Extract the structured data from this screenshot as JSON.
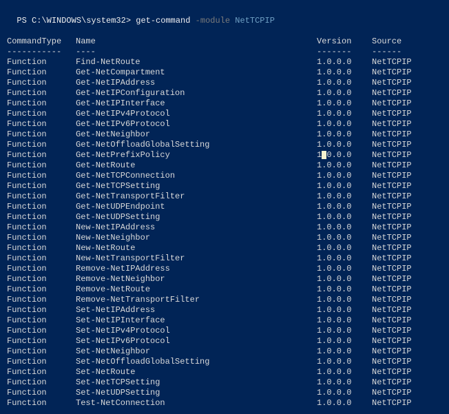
{
  "prompt": {
    "path": "PS C:\\WINDOWS\\system32>",
    "command": "get-command",
    "parameter": "-module",
    "argument": "NetTCPIP"
  },
  "headers": {
    "type": "CommandType",
    "name": "Name",
    "version": "Version",
    "source": "Source"
  },
  "dashes": {
    "type": "-----------",
    "name": "----",
    "version": "-------",
    "source": "------"
  },
  "cursor_row_index": 9,
  "chart_data": {
    "type": "table",
    "title": "get-command -module NetTCPIP",
    "columns": [
      "CommandType",
      "Name",
      "Version",
      "Source"
    ],
    "rows": [
      [
        "Function",
        "Find-NetRoute",
        "1.0.0.0",
        "NetTCPIP"
      ],
      [
        "Function",
        "Get-NetCompartment",
        "1.0.0.0",
        "NetTCPIP"
      ],
      [
        "Function",
        "Get-NetIPAddress",
        "1.0.0.0",
        "NetTCPIP"
      ],
      [
        "Function",
        "Get-NetIPConfiguration",
        "1.0.0.0",
        "NetTCPIP"
      ],
      [
        "Function",
        "Get-NetIPInterface",
        "1.0.0.0",
        "NetTCPIP"
      ],
      [
        "Function",
        "Get-NetIPv4Protocol",
        "1.0.0.0",
        "NetTCPIP"
      ],
      [
        "Function",
        "Get-NetIPv6Protocol",
        "1.0.0.0",
        "NetTCPIP"
      ],
      [
        "Function",
        "Get-NetNeighbor",
        "1.0.0.0",
        "NetTCPIP"
      ],
      [
        "Function",
        "Get-NetOffloadGlobalSetting",
        "1.0.0.0",
        "NetTCPIP"
      ],
      [
        "Function",
        "Get-NetPrefixPolicy",
        "1.0.0.0",
        "NetTCPIP"
      ],
      [
        "Function",
        "Get-NetRoute",
        "1.0.0.0",
        "NetTCPIP"
      ],
      [
        "Function",
        "Get-NetTCPConnection",
        "1.0.0.0",
        "NetTCPIP"
      ],
      [
        "Function",
        "Get-NetTCPSetting",
        "1.0.0.0",
        "NetTCPIP"
      ],
      [
        "Function",
        "Get-NetTransportFilter",
        "1.0.0.0",
        "NetTCPIP"
      ],
      [
        "Function",
        "Get-NetUDPEndpoint",
        "1.0.0.0",
        "NetTCPIP"
      ],
      [
        "Function",
        "Get-NetUDPSetting",
        "1.0.0.0",
        "NetTCPIP"
      ],
      [
        "Function",
        "New-NetIPAddress",
        "1.0.0.0",
        "NetTCPIP"
      ],
      [
        "Function",
        "New-NetNeighbor",
        "1.0.0.0",
        "NetTCPIP"
      ],
      [
        "Function",
        "New-NetRoute",
        "1.0.0.0",
        "NetTCPIP"
      ],
      [
        "Function",
        "New-NetTransportFilter",
        "1.0.0.0",
        "NetTCPIP"
      ],
      [
        "Function",
        "Remove-NetIPAddress",
        "1.0.0.0",
        "NetTCPIP"
      ],
      [
        "Function",
        "Remove-NetNeighbor",
        "1.0.0.0",
        "NetTCPIP"
      ],
      [
        "Function",
        "Remove-NetRoute",
        "1.0.0.0",
        "NetTCPIP"
      ],
      [
        "Function",
        "Remove-NetTransportFilter",
        "1.0.0.0",
        "NetTCPIP"
      ],
      [
        "Function",
        "Set-NetIPAddress",
        "1.0.0.0",
        "NetTCPIP"
      ],
      [
        "Function",
        "Set-NetIPInterface",
        "1.0.0.0",
        "NetTCPIP"
      ],
      [
        "Function",
        "Set-NetIPv4Protocol",
        "1.0.0.0",
        "NetTCPIP"
      ],
      [
        "Function",
        "Set-NetIPv6Protocol",
        "1.0.0.0",
        "NetTCPIP"
      ],
      [
        "Function",
        "Set-NetNeighbor",
        "1.0.0.0",
        "NetTCPIP"
      ],
      [
        "Function",
        "Set-NetOffloadGlobalSetting",
        "1.0.0.0",
        "NetTCPIP"
      ],
      [
        "Function",
        "Set-NetRoute",
        "1.0.0.0",
        "NetTCPIP"
      ],
      [
        "Function",
        "Set-NetTCPSetting",
        "1.0.0.0",
        "NetTCPIP"
      ],
      [
        "Function",
        "Set-NetUDPSetting",
        "1.0.0.0",
        "NetTCPIP"
      ],
      [
        "Function",
        "Test-NetConnection",
        "1.0.0.0",
        "NetTCPIP"
      ]
    ]
  }
}
